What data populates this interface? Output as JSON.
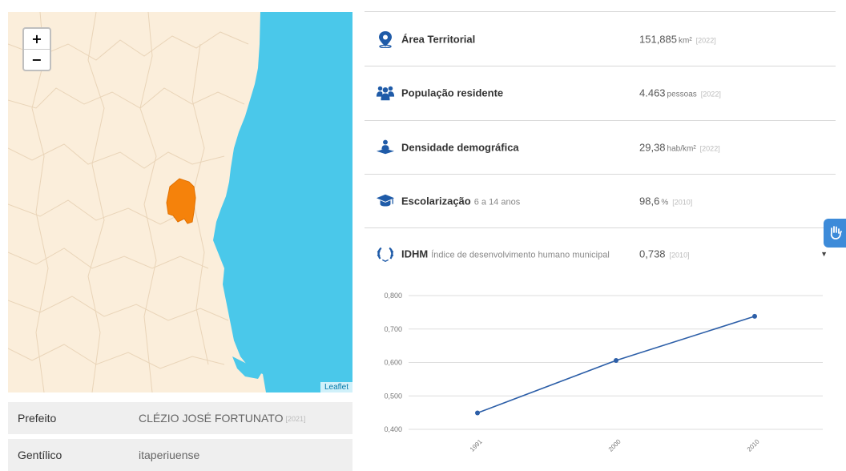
{
  "map": {
    "zoom_in": "+",
    "zoom_out": "−",
    "attribution": "Leaflet",
    "colors": {
      "land": "#fbeedb",
      "sea": "#4ac8ea",
      "highlight": "#f5820b",
      "border": "#e8d3b6"
    }
  },
  "info": {
    "mayor_label": "Prefeito",
    "mayor_value": "CLÉZIO JOSÉ FORTUNATO",
    "mayor_year": "[2021]",
    "gentilic_label": "Gentílico",
    "gentilic_value": "itaperiuense"
  },
  "indicators": {
    "area": {
      "icon": "map-marker-icon",
      "label": "Área Territorial",
      "value": "151,885",
      "unit": "km²",
      "year": "[2022]"
    },
    "population": {
      "icon": "people-icon",
      "label": "População residente",
      "value": "4.463",
      "unit": "pessoas",
      "year": "[2022]"
    },
    "density": {
      "icon": "person-density-icon",
      "label": "Densidade demográfica",
      "value": "29,38",
      "unit": "hab/km²",
      "year": "[2022]"
    },
    "schooling": {
      "icon": "graduation-cap-icon",
      "label": "Escolarização",
      "sub": "6 a 14 anos",
      "value": "98,6",
      "unit": "%",
      "year": "[2010]"
    },
    "idhm": {
      "icon": "laurel-icon",
      "label": "IDHM",
      "sub": "Índice de desenvolvimento humano municipal",
      "value": "0,738",
      "year": "[2010]",
      "caret": "▼"
    }
  },
  "accent_color": "#1f5ba8",
  "chart_data": {
    "type": "line",
    "categories": [
      "1991",
      "2000",
      "2010"
    ],
    "values": [
      0.449,
      0.606,
      0.738
    ],
    "yticks": [
      "0,400",
      "0,500",
      "0,600",
      "0,700",
      "0,800"
    ],
    "ylim": [
      0.4,
      0.8
    ],
    "grid": true,
    "color": "#2d5fa8"
  }
}
